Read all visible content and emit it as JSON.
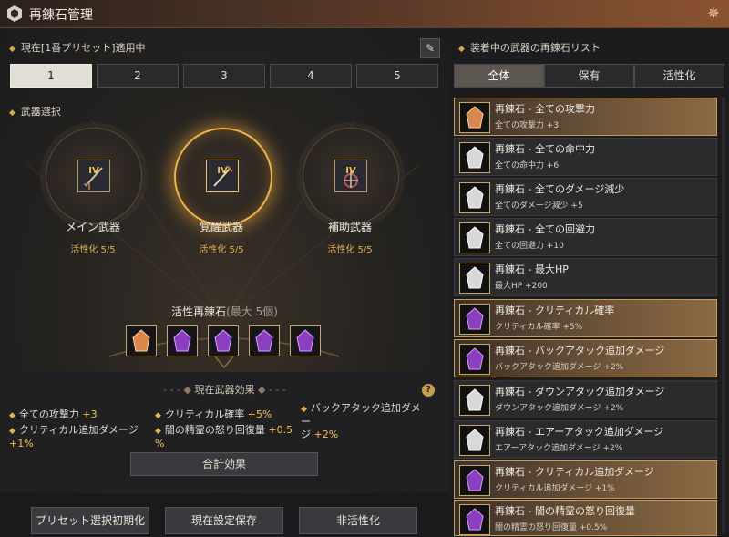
{
  "window": {
    "title": "再錬石管理"
  },
  "left": {
    "preset_label": "現在[1番プリセット]適用中",
    "preset_tabs": [
      "1",
      "2",
      "3",
      "4",
      "5"
    ],
    "active_preset_index": 0,
    "weapon_section_label": "武器選択",
    "weapons": [
      {
        "name": "メイン武器",
        "activation": "活性化 5/5",
        "rank": "IV"
      },
      {
        "name": "覚醒武器",
        "activation": "活性化 5/5",
        "rank": "IV"
      },
      {
        "name": "補助武器",
        "activation": "活性化 5/5",
        "rank": "IV"
      }
    ],
    "active_weapon_index": 1,
    "gems_label": "活性再錬石",
    "gems_sub": "(最大 5個)",
    "current_effect_title": "現在武器効果",
    "effects": [
      {
        "label": "全ての攻撃力",
        "value": "+3"
      },
      {
        "label": "クリティカル確率",
        "value": "+5%"
      },
      {
        "label": "バックアタック追加ダメー",
        "label2": "ジ",
        "value": "+2%"
      },
      {
        "label": "クリティカル追加ダメージ",
        "value": "+1%"
      },
      {
        "label": "闇の精霊の怒り回復量",
        "value": "+0.5",
        "value2": "%"
      }
    ],
    "total_button": "合計効果",
    "buttons": {
      "reset": "プリセット選択初期化",
      "save": "現在設定保存",
      "deactivate": "非活性化"
    }
  },
  "right": {
    "list_title": "装着中の武器の再錬石リスト",
    "filter_tabs": [
      "全体",
      "保有",
      "活性化"
    ],
    "active_filter_index": 0,
    "items": [
      {
        "name": "再錬石 - 全ての攻撃力",
        "desc": "全ての攻撃力 +3",
        "active": true,
        "gem": "orange"
      },
      {
        "name": "再錬石 - 全ての命中力",
        "desc": "全ての命中力 +6",
        "active": false,
        "gem": "white"
      },
      {
        "name": "再錬石 - 全てのダメージ減少",
        "desc": "全てのダメージ減少 +5",
        "active": false,
        "gem": "white"
      },
      {
        "name": "再錬石 - 全ての回避力",
        "desc": "全ての回避力 +10",
        "active": false,
        "gem": "white"
      },
      {
        "name": "再錬石 - 最大HP",
        "desc": "最大HP +200",
        "active": false,
        "gem": "white"
      },
      {
        "name": "再錬石 - クリティカル確率",
        "desc": "クリティカル確率 +5%",
        "active": true,
        "gem": "purple"
      },
      {
        "name": "再錬石 - バックアタック追加ダメージ",
        "desc": "バックアタック追加ダメージ +2%",
        "active": true,
        "gem": "purple"
      },
      {
        "name": "再錬石 - ダウンアタック追加ダメージ",
        "desc": "ダウンアタック追加ダメージ +2%",
        "active": false,
        "gem": "white"
      },
      {
        "name": "再錬石 - エアーアタック追加ダメージ",
        "desc": "エアーアタック追加ダメージ +2%",
        "active": false,
        "gem": "white"
      },
      {
        "name": "再錬石 - クリティカル追加ダメージ",
        "desc": "クリティカル追加ダメージ +1%",
        "active": true,
        "gem": "purple"
      },
      {
        "name": "再錬石 - 闇の精霊の怒り回復量",
        "desc": "闇の精霊の怒り回復量 +0.5%",
        "active": true,
        "gem": "purple"
      }
    ]
  },
  "colors": {
    "accent": "#e0b050",
    "active_border": "#c79a55",
    "gem_orange": "#d9874a",
    "gem_purple": "#8a3fc0",
    "gem_white": "#d8d8d8"
  },
  "icons": {
    "title": "emblem-icon",
    "title_right": "star-ornament-icon",
    "edit": "pencil-icon",
    "help": "question-icon"
  }
}
